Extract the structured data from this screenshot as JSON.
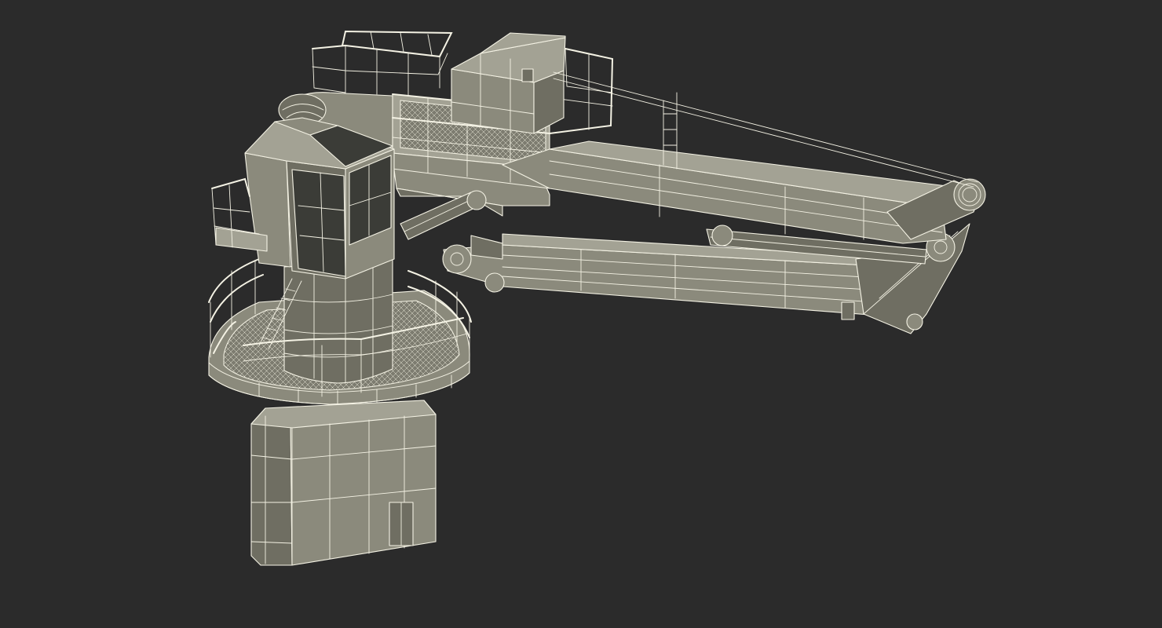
{
  "scene": {
    "background_color": "#2b2b2b",
    "wire_color": "#f4f2e4",
    "surface_color": "#8b8a7c",
    "glass_color": "#3b3c37"
  }
}
